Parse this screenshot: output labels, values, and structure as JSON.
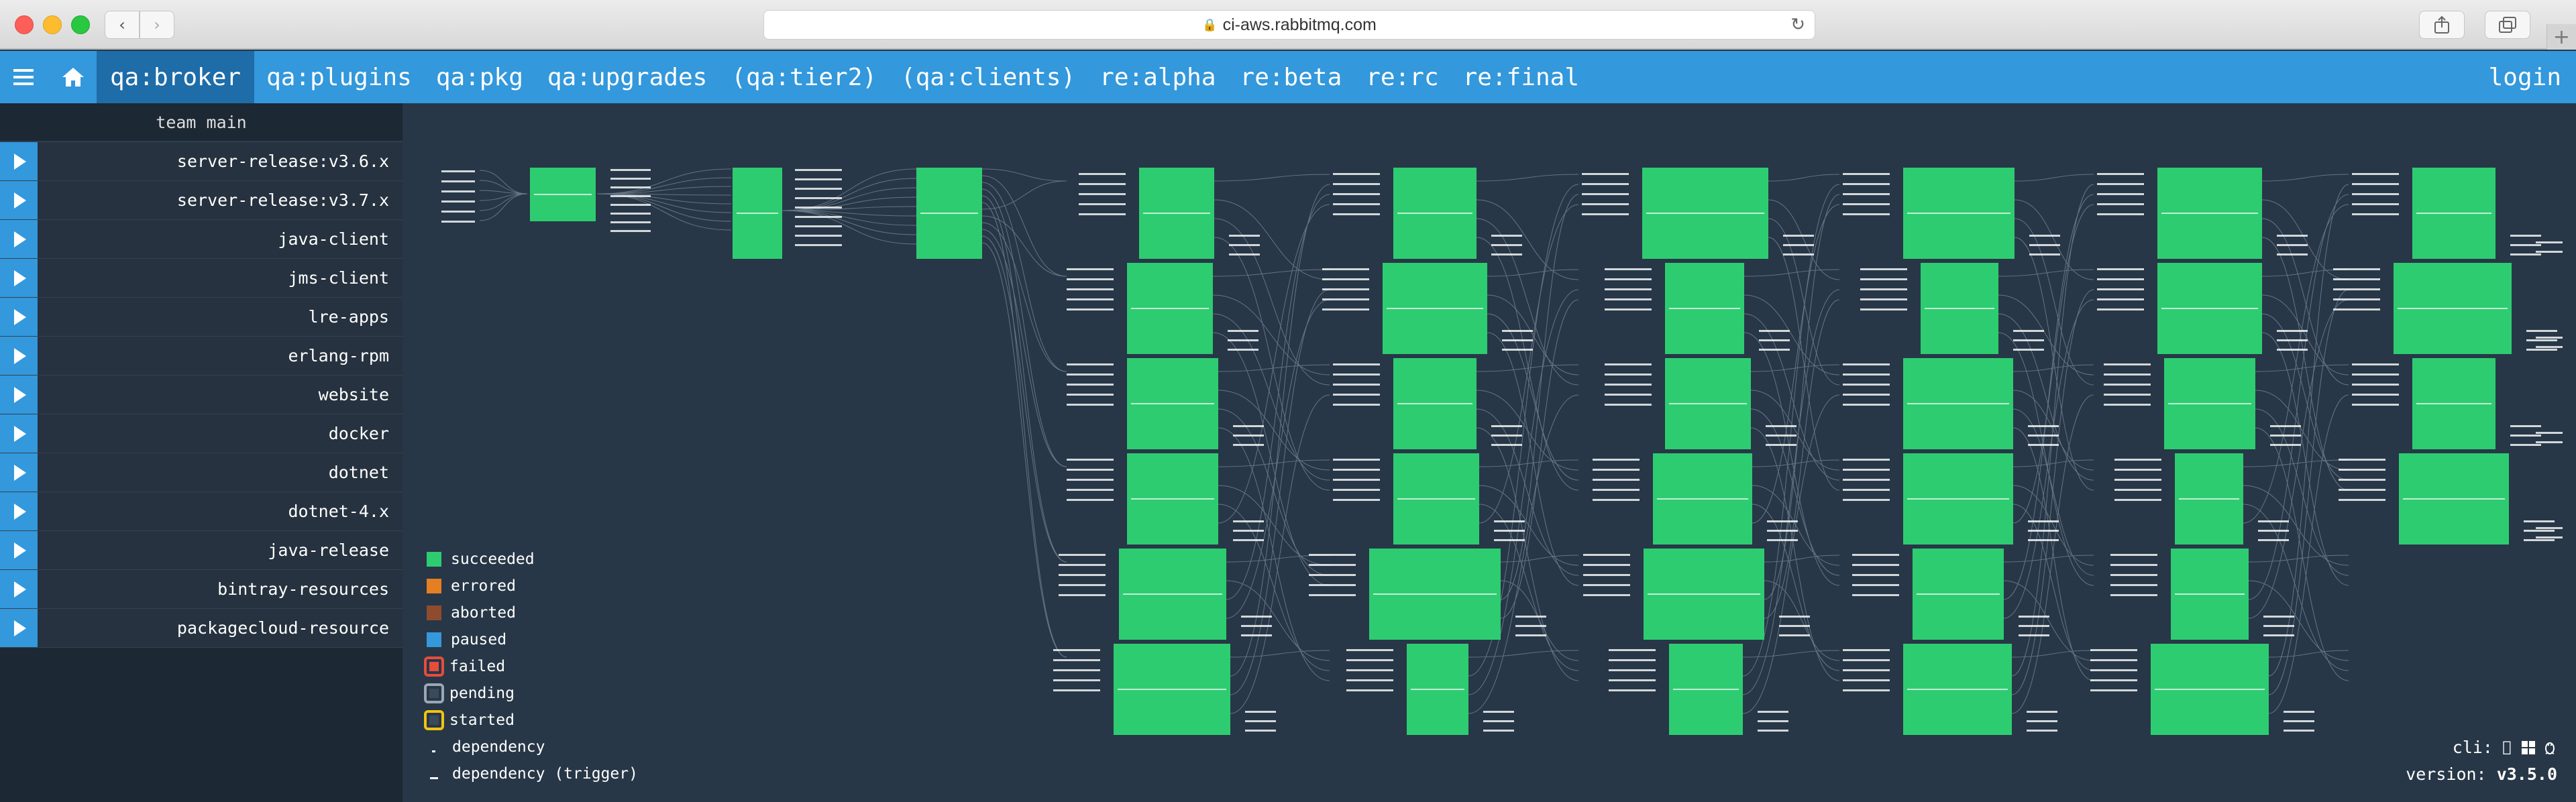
{
  "browser": {
    "url": "ci-aws.rabbitmq.com"
  },
  "nav": {
    "pipelines": [
      {
        "label": "qa:broker",
        "active": true
      },
      {
        "label": "qa:plugins",
        "active": false
      },
      {
        "label": "qa:pkg",
        "active": false
      },
      {
        "label": "qa:upgrades",
        "active": false
      },
      {
        "label": "(qa:tier2)",
        "active": false
      },
      {
        "label": "(qa:clients)",
        "active": false
      },
      {
        "label": "re:alpha",
        "active": false
      },
      {
        "label": "re:beta",
        "active": false
      },
      {
        "label": "re:rc",
        "active": false
      },
      {
        "label": "re:final",
        "active": false
      }
    ],
    "login": "login"
  },
  "sidebar": {
    "team": "team main",
    "pipelines": [
      "server-release:v3.6.x",
      "server-release:v3.7.x",
      "java-client",
      "jms-client",
      "lre-apps",
      "erlang-rpm",
      "website",
      "docker",
      "dotnet",
      "dotnet-4.x",
      "java-release",
      "bintray-resources",
      "packagecloud-resource"
    ]
  },
  "legend": [
    {
      "label": "succeeded",
      "kind": "succeeded"
    },
    {
      "label": "errored",
      "kind": "errored"
    },
    {
      "label": "aborted",
      "kind": "aborted"
    },
    {
      "label": "paused",
      "kind": "paused"
    },
    {
      "label": "failed",
      "kind": "failed"
    },
    {
      "label": "pending",
      "kind": "pending"
    },
    {
      "label": "started",
      "kind": "started"
    },
    {
      "label": "dependency",
      "kind": "dep"
    },
    {
      "label": "dependency (trigger)",
      "kind": "dep-trigger"
    }
  ],
  "footer": {
    "cli_label": "cli:",
    "cli_icons": [
      "apple-icon",
      "windows-icon",
      "linux-icon"
    ],
    "version_label": "version:",
    "version_value": "v3.5.0"
  },
  "colors": {
    "nav_bg": "#3398dc",
    "nav_active": "#1e6ca8",
    "canvas_bg": "#273747",
    "job_succeeded": "#2ecc71"
  }
}
